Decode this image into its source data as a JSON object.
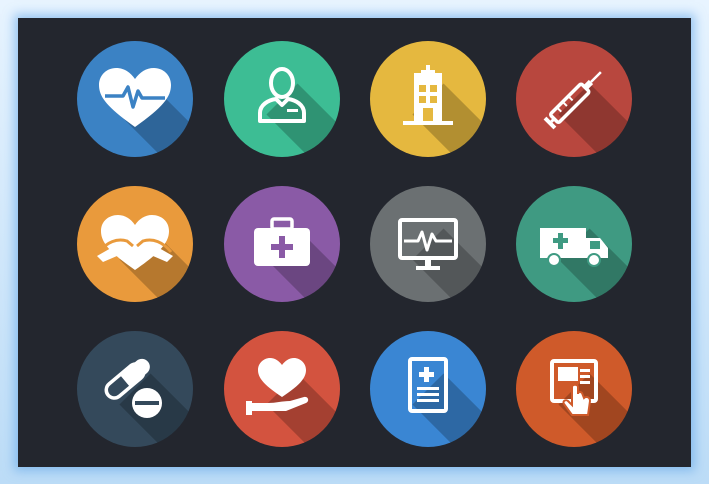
{
  "icons": [
    {
      "name": "heartbeat-icon",
      "color": "#3b82c4"
    },
    {
      "name": "doctor-icon",
      "color": "#3dbd94"
    },
    {
      "name": "hospital-icon",
      "color": "#e5b83f"
    },
    {
      "name": "syringe-icon",
      "color": "#b8473e"
    },
    {
      "name": "hands-heart-icon",
      "color": "#e99a3c"
    },
    {
      "name": "first-aid-kit-icon",
      "color": "#8a5aa6"
    },
    {
      "name": "ecg-monitor-icon",
      "color": "#6b7072"
    },
    {
      "name": "ambulance-icon",
      "color": "#3f9a82"
    },
    {
      "name": "pills-icon",
      "color": "#34495b"
    },
    {
      "name": "heart-in-hand-icon",
      "color": "#d3533f"
    },
    {
      "name": "medical-report-icon",
      "color": "#3a86d3"
    },
    {
      "name": "touch-screen-medical-icon",
      "color": "#cf5a2a"
    }
  ]
}
